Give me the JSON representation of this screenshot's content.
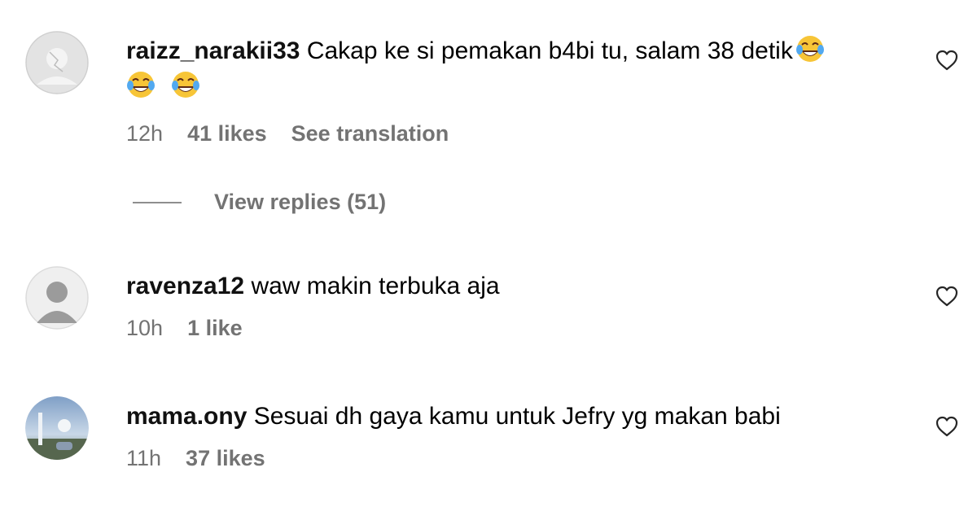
{
  "comments": [
    {
      "username": "raizz_narakii33",
      "text": "Cakap ke si pemakan b4bi tu, salam 38 detik",
      "time": "12h",
      "likes": "41 likes",
      "translation": "See translation",
      "avatar": "broken-image-avatar",
      "emoji": "face-with-tears-of-joy-icon"
    },
    {
      "username": "ravenza12",
      "text": "waw makin terbuka aja",
      "time": "10h",
      "likes": "1 like",
      "avatar": "default-user-avatar"
    },
    {
      "username": "mama.ony",
      "text": "Sesuai dh gaya kamu untuk Jefry yg makan babi",
      "time": "11h",
      "likes": "37 likes",
      "avatar": "photo-avatar"
    }
  ],
  "replies": {
    "label": "View replies (51)"
  },
  "colors": {
    "secondary_text": "#737373",
    "primary_text": "#000000"
  }
}
